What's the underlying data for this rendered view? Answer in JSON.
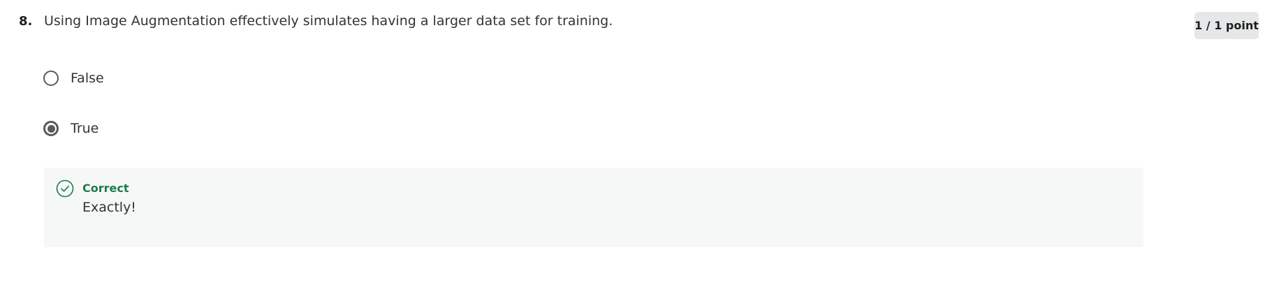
{
  "question": {
    "number": "8.",
    "text": "Using Image Augmentation effectively simulates having a larger data set for training.",
    "points": "1 / 1 point"
  },
  "options": [
    {
      "label": "False",
      "selected": false
    },
    {
      "label": "True",
      "selected": true
    }
  ],
  "feedback": {
    "status": "Correct",
    "message": "Exactly!",
    "icon": "check-circle-icon",
    "status_color": "#1f7a4d"
  }
}
